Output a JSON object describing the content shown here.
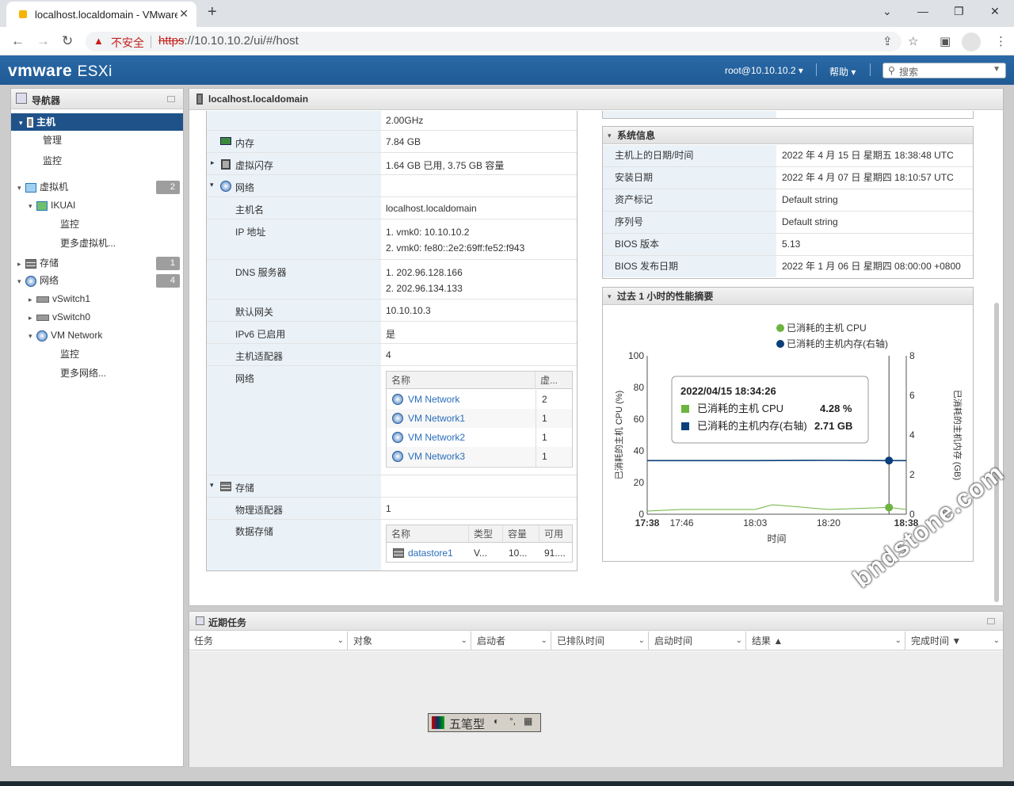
{
  "browser": {
    "tab_title": "localhost.localdomain - VMware ESXi",
    "new_tab": "+",
    "insecure_label": "不安全",
    "url_proto": "https",
    "url_rest": "://10.10.10.2/ui/#/host",
    "win_min": "⌄",
    "win_minimize": "—",
    "win_restore": "❐",
    "win_close": "✕"
  },
  "header": {
    "brand": "vmware",
    "product": "ESXi",
    "user": "root@10.10.10.2 ▾",
    "help": "帮助 ▾",
    "search_placeholder": "搜索"
  },
  "navigator": {
    "title": "导航器",
    "items": [
      {
        "label": "主机",
        "selected": true
      },
      {
        "label": "管理"
      },
      {
        "label": "监控"
      },
      {
        "label": "虚拟机",
        "badge": "2"
      },
      {
        "label": "IKUAI"
      },
      {
        "label": "监控"
      },
      {
        "label": "更多虚拟机..."
      },
      {
        "label": "存储",
        "badge": "1"
      },
      {
        "label": "网络",
        "badge": "4"
      },
      {
        "label": "vSwitch1"
      },
      {
        "label": "vSwitch0"
      },
      {
        "label": "VM Network"
      },
      {
        "label": "监控"
      },
      {
        "label": "更多网络..."
      }
    ]
  },
  "main": {
    "title": "localhost.localdomain",
    "hardware": {
      "cpu_freq": "2.00GHz",
      "memory_label": "内存",
      "memory_value": "7.84 GB",
      "flash_label": "虚拟闪存",
      "flash_value": "1.64 GB 已用, 3.75 GB 容量",
      "network_label": "网络",
      "hostname_label": "主机名",
      "hostname_value": "localhost.localdomain",
      "ip_label": "IP 地址",
      "ip_1": "1. vmk0: 10.10.10.2",
      "ip_2": "2. vmk0: fe80::2e2:69ff:fe52:f943",
      "dns_label": "DNS 服务器",
      "dns_1": "1. 202.96.128.166",
      "dns_2": "2. 202.96.134.133",
      "gw_label": "默认网关",
      "gw_value": "10.10.10.3",
      "ipv6_label": "IPv6 已启用",
      "ipv6_value": "是",
      "adapters_label": "主机适配器",
      "adapters_value": "4",
      "networks_label": "网络",
      "net_table": {
        "col_name": "名称",
        "col_vms": "虚...",
        "rows": [
          {
            "name": "VM Network",
            "vms": "2"
          },
          {
            "name": "VM Network1",
            "vms": "1"
          },
          {
            "name": "VM Network2",
            "vms": "1"
          },
          {
            "name": "VM Network3",
            "vms": "1"
          }
        ]
      },
      "storage_label": "存储",
      "phys_label": "物理适配器",
      "phys_value": "1",
      "ds_label": "数据存储",
      "ds_table": {
        "col_name": "名称",
        "col_type": "类型",
        "col_cap": "容量",
        "col_free": "可用",
        "rows": [
          {
            "name": "datastore1",
            "type": "V...",
            "cap": "10...",
            "free": "91...."
          }
        ]
      }
    },
    "sysinfo": {
      "title": "系统信息",
      "rows": [
        {
          "label": "主机上的日期/时间",
          "value": "2022 年 4 月 15 日 星期五 18:38:48 UTC"
        },
        {
          "label": "安装日期",
          "value": "2022 年 4 月 07 日 星期四 18:10:57 UTC"
        },
        {
          "label": "资产标记",
          "value": "Default string"
        },
        {
          "label": "序列号",
          "value": "Default string"
        },
        {
          "label": "BIOS 版本",
          "value": "5.13"
        },
        {
          "label": "BIOS 发布日期",
          "value": "2022 年 1 月 06 日 星期四 08:00:00 +0800"
        }
      ]
    },
    "perf_title": "过去 1 小时的性能摘要"
  },
  "chart_data": {
    "type": "line",
    "title": "",
    "xlabel": "时间",
    "ylabel": "已消耗的主机 CPU (%)",
    "y2label": "已消耗的主机内存 (GB)",
    "ylim": [
      0,
      100
    ],
    "y2lim": [
      0,
      8
    ],
    "x_ticks": [
      "17:38",
      "17:46",
      "18:03",
      "18:20",
      "18:38"
    ],
    "y_ticks": [
      "0",
      "20",
      "40",
      "60",
      "80",
      "100"
    ],
    "y2_ticks": [
      "0",
      "2",
      "4",
      "6",
      "8"
    ],
    "legend_position": "top-right",
    "series": [
      {
        "name": "已消耗的主机 CPU",
        "color": "#6db33f",
        "axis": "left",
        "x": [
          "17:38",
          "17:46",
          "18:03",
          "18:07",
          "18:20",
          "18:34",
          "18:38"
        ],
        "values": [
          2,
          3,
          3,
          6,
          3,
          4.28,
          3
        ]
      },
      {
        "name": "已消耗的主机内存(右轴)",
        "color": "#0b3f7a",
        "axis": "right",
        "x": [
          "17:38",
          "18:03",
          "18:20",
          "18:34",
          "18:38"
        ],
        "values": [
          2.71,
          2.71,
          2.72,
          2.71,
          2.71
        ]
      }
    ],
    "tooltip": {
      "time": "2022/04/15 18:34:26",
      "cpu_label": "已消耗的主机 CPU",
      "cpu_value": "4.28 %",
      "mem_label": "已消耗的主机内存(右轴)",
      "mem_value": "2.71 GB"
    }
  },
  "tasks": {
    "title": "近期任务",
    "columns": [
      "任务",
      "对象",
      "启动者",
      "已排队时间",
      "启动时间",
      "结果 ▲",
      "完成时间 ▼"
    ]
  },
  "ime": {
    "label": "五笔型"
  },
  "watermark": "bndstone.com",
  "colors": {
    "header": "#1f5a94",
    "selected": "#20528a",
    "cpu": "#6db33f",
    "mem": "#0b3f7a"
  }
}
